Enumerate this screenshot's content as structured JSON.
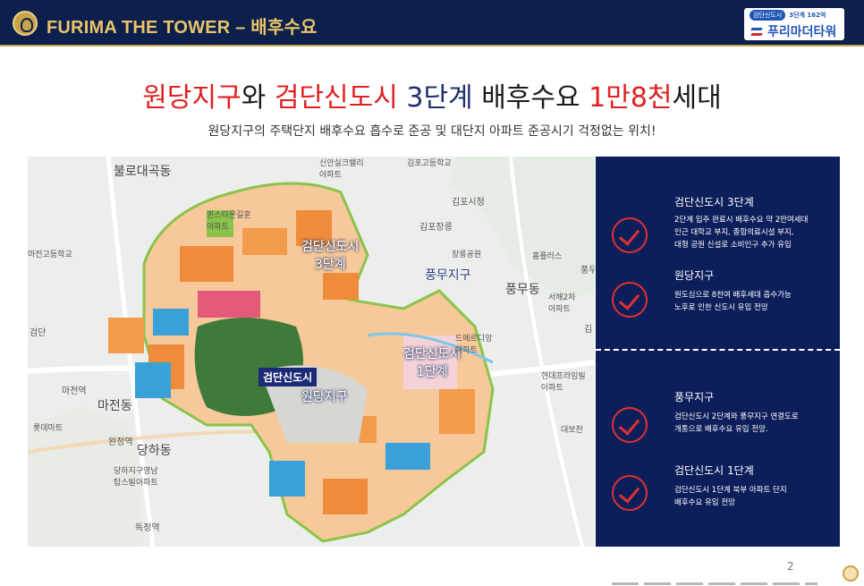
{
  "header": {
    "title": "FURIMA THE TOWER – 배후수요",
    "brand": {
      "pill": "검단신도시",
      "tagline": "3단계 162억",
      "name": "푸리마더타워"
    }
  },
  "headline": {
    "part1": "원당지구",
    "part2": "와 ",
    "part3": "검단신도시",
    "part4": " 3단계",
    "part5": " 배후수요 ",
    "part6": "1만8천",
    "part7": "세대"
  },
  "subheadline": "원당지구의 주택단지 배후수요 흡수로 준공 및 대단지 아파트 준공시기 걱정없는 위치!",
  "map": {
    "labels": {
      "bullo": "불로대곡동",
      "guinsa": "퀸스타운길훈\n아파트",
      "majeon_high": "마전고등학교",
      "geomdan": "검단",
      "majeon_station": "마전역",
      "majeon_dong": "마전동",
      "lotte": "롯데마트",
      "wanjeong": "완정역",
      "dangha": "당하동",
      "dangha_apt": "당하지구영남\n탑스빌아파트",
      "dokjeong": "독정역",
      "phase3": "검단신도시\n3단계",
      "geomdan_box": "검단신도시",
      "wondang": "원당지구",
      "phase1": "검단신도시\n1단계",
      "pungmu_zone": "풍무지구",
      "pungmu_dong": "풍무동",
      "gimpo_high": "김포고등학교",
      "gimpo_city": "김포시청",
      "gimpo_tomb": "김포장릉",
      "jangneung_park": "장릉공원",
      "homeplus": "홈플러스",
      "seohae_apt": "서해2차\n아파트",
      "demerodian": "드메르디앙\n아파트",
      "hyundai_prime": "현대프라임빌\n아파트",
      "sinan": "신안실크밸리\n아파트",
      "pung": "풍무",
      "gim": "김",
      "daebo": "대보천"
    }
  },
  "panel": {
    "items": [
      {
        "title": "검단신도시 3단계",
        "desc": "2단계 입주 완료시 배후수요 약 2만여세대\n인근 대학교 부지, 종합의료시설 부지,\n대형 공원 신설로 소비인구 추가 유입"
      },
      {
        "title": "원당지구",
        "desc": "원도심으로 8천여 배후세대 흡수가능\n노후로 인한 신도시 유입 전망"
      },
      {
        "title": "풍무지구",
        "desc": "검단신도시 2단계와 풍무지구 연결도로\n개통으로 배후수요 유입 전망."
      },
      {
        "title": "검단신도시 1단계",
        "desc": "검단신도시 1단계 북부 아파트 단지\n배후수요 유입 전망"
      }
    ]
  },
  "page_number": "2",
  "colors": {
    "navy": "#0d1f5a",
    "gold": "#e9c46a",
    "accent_red": "#e02020"
  }
}
